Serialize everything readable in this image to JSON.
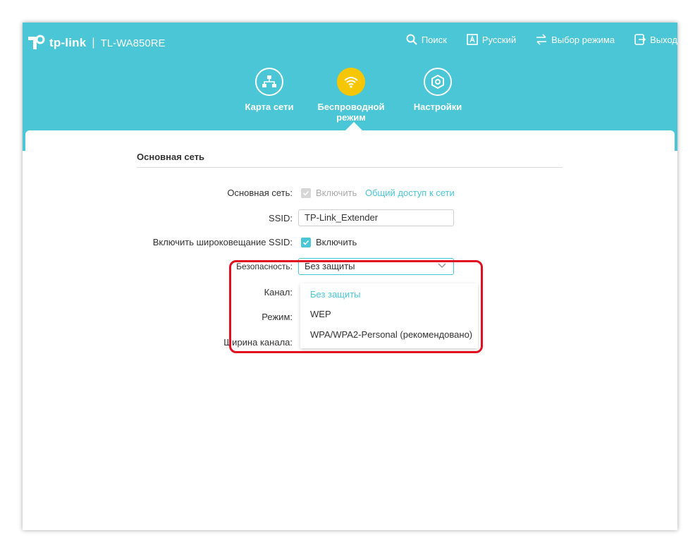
{
  "brand": {
    "logo_text": "tp-link",
    "separator": "|",
    "model": "TL-WA850RE"
  },
  "topbar": {
    "search": "Поиск",
    "language": "Русский",
    "mode": "Выбор режима",
    "logout": "Выход"
  },
  "nav": {
    "network_map": "Карта сети",
    "wireless": "Беспроводной режим",
    "settings": "Настройки"
  },
  "section": {
    "title": "Основная сеть"
  },
  "form": {
    "main_network_label": "Основная сеть:",
    "main_network_enable": "Включить",
    "share_link": "Общий доступ к сети",
    "ssid_label": "SSID:",
    "ssid_value": "TP-Link_Extender",
    "broadcast_label": "Включить широковещание SSID:",
    "broadcast_enable": "Включить",
    "security_label": "Безопасность:",
    "security_value": "Без защиты",
    "channel_label": "Канал:",
    "mode_label": "Режим:",
    "width_label": "Ширина канала:"
  },
  "dropdown": {
    "options": [
      "Без защиты",
      "WEP",
      "WPA/WPA2-Personal (рекомендовано)"
    ]
  },
  "colors": {
    "header": "#4ac6d6",
    "active_nav": "#f6c700",
    "highlight": "#e01020"
  }
}
